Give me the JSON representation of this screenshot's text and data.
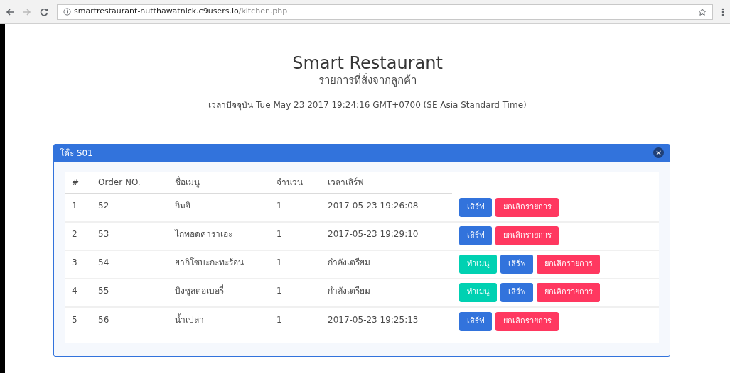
{
  "browser": {
    "url_host": "smartrestaurant-nutthawatnick.c9users.io",
    "url_path": "/kitchen.php"
  },
  "header": {
    "title": "Smart Restaurant",
    "subtitle": "รายการที่สั่งจากลูกค้า",
    "clock": "เวลาปัจจุบัน Tue May 23 2017 19:24:16 GMT+0700 (SE Asia Standard Time)"
  },
  "panel": {
    "title": "โต๊ะ S01",
    "close": "×",
    "table": {
      "columns": [
        "#",
        "Order NO.",
        "ชื่อเมนู",
        "จำนวน",
        "เวลาเสิร์ฟ"
      ],
      "rows": [
        {
          "cells": [
            "1",
            "52",
            "กิมจิ",
            "1",
            "2017-05-23 19:26:08"
          ],
          "buttons": [
            {
              "kind": "serve",
              "label": "เสิร์ฟ"
            },
            {
              "kind": "cancel",
              "label": "ยกเลิกรายการ"
            }
          ]
        },
        {
          "cells": [
            "2",
            "53",
            "ไก่ทอดคาราเอะ",
            "1",
            "2017-05-23 19:29:10"
          ],
          "buttons": [
            {
              "kind": "serve",
              "label": "เสิร์ฟ"
            },
            {
              "kind": "cancel",
              "label": "ยกเลิกรายการ"
            }
          ]
        },
        {
          "cells": [
            "3",
            "54",
            "ยากิโซบะกะทะร้อน",
            "1",
            "กำลังเตรียม"
          ],
          "buttons": [
            {
              "kind": "cook",
              "label": "ทำเมนู"
            },
            {
              "kind": "serve",
              "label": "เสิร์ฟ"
            },
            {
              "kind": "cancel",
              "label": "ยกเลิกรายการ"
            }
          ]
        },
        {
          "cells": [
            "4",
            "55",
            "บิงซูสตอเบอรี่",
            "1",
            "กำลังเตรียม"
          ],
          "buttons": [
            {
              "kind": "cook",
              "label": "ทำเมนู"
            },
            {
              "kind": "serve",
              "label": "เสิร์ฟ"
            },
            {
              "kind": "cancel",
              "label": "ยกเลิกรายการ"
            }
          ]
        },
        {
          "cells": [
            "5",
            "56",
            "น้ำเปล่า",
            "1",
            "2017-05-23 19:25:13"
          ],
          "buttons": [
            {
              "kind": "serve",
              "label": "เสิร์ฟ"
            },
            {
              "kind": "cancel",
              "label": "ยกเลิกรายการ"
            }
          ]
        }
      ]
    }
  }
}
